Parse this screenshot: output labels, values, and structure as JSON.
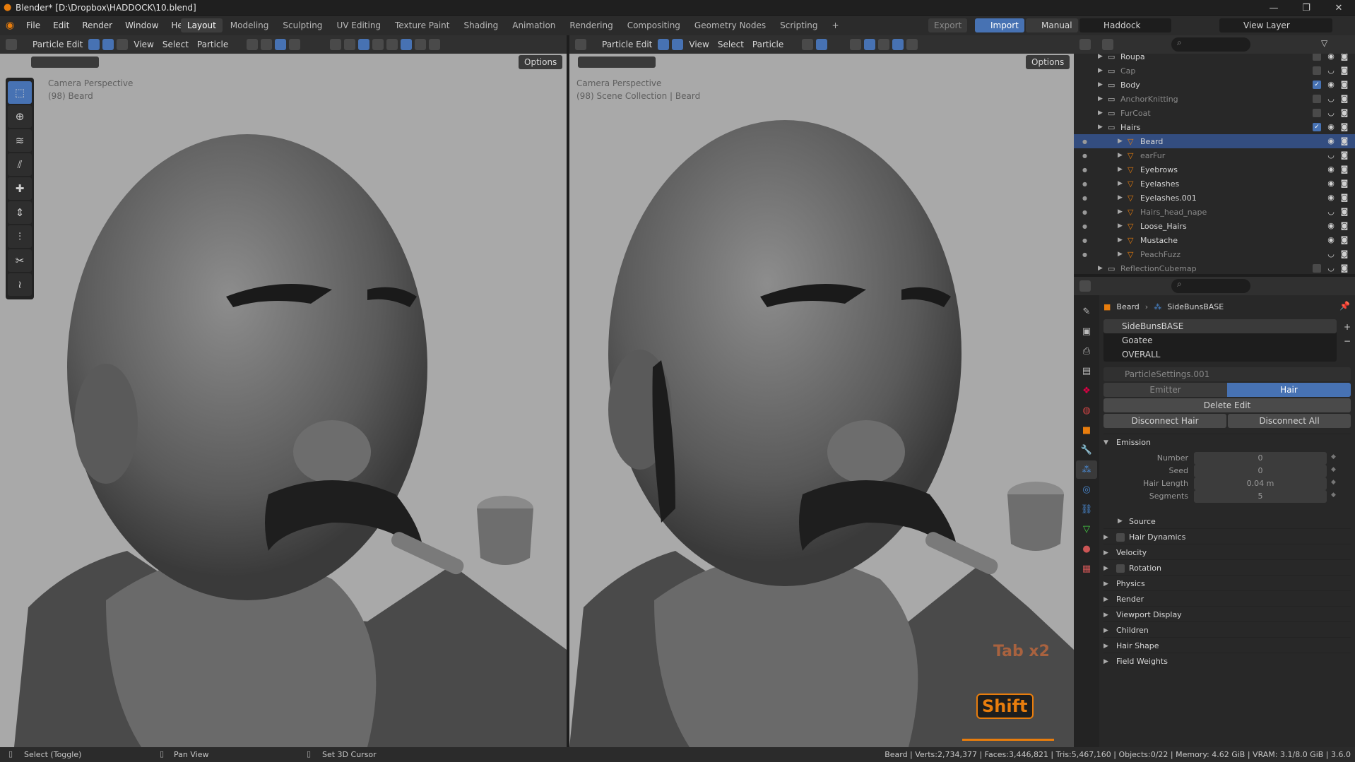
{
  "window": {
    "title": "Blender* [D:\\Dropbox\\HADDOCK\\10.blend]"
  },
  "menu": [
    "File",
    "Edit",
    "Render",
    "Window",
    "Help"
  ],
  "workspaces": [
    "Layout",
    "Modeling",
    "Sculpting",
    "UV Editing",
    "Texture Paint",
    "Shading",
    "Animation",
    "Rendering",
    "Compositing",
    "Geometry Nodes",
    "Scripting"
  ],
  "topright": {
    "export": "Export",
    "import": "Import",
    "manual": "Manual",
    "scene": "Haddock",
    "view_layer": "View Layer"
  },
  "viewport_left": {
    "mode": "Particle Edit",
    "view": "View",
    "select": "Select",
    "particle": "Particle",
    "options": "Options",
    "overlay_line1": "Camera Perspective",
    "overlay_line2": "(98) Beard"
  },
  "viewport_right": {
    "mode": "Particle Edit",
    "view": "View",
    "select": "Select",
    "particle": "Particle",
    "options": "Options",
    "overlay_line1": "Camera Perspective",
    "overlay_line2": "(98) Scene Collection | Beard",
    "hint_tab": "Tab x2",
    "hint_shift": "Shift"
  },
  "outliner": {
    "rows": [
      {
        "name": "Roupa",
        "indent": 0,
        "dim": false,
        "sel": false,
        "checked": false
      },
      {
        "name": "Cap",
        "indent": 0,
        "dim": true,
        "sel": false,
        "checked": false
      },
      {
        "name": "Body",
        "indent": 0,
        "dim": false,
        "sel": false,
        "checked": true
      },
      {
        "name": "AnchorKnitting",
        "indent": 0,
        "dim": true,
        "sel": false,
        "checked": false
      },
      {
        "name": "FurCoat",
        "indent": 0,
        "dim": true,
        "sel": false,
        "checked": false
      },
      {
        "name": "Hairs",
        "indent": 0,
        "dim": false,
        "sel": false,
        "checked": true
      },
      {
        "name": "Beard",
        "indent": 1,
        "dim": false,
        "sel": true,
        "checked": false
      },
      {
        "name": "earFur",
        "indent": 1,
        "dim": true,
        "sel": false,
        "checked": false
      },
      {
        "name": "Eyebrows",
        "indent": 1,
        "dim": false,
        "sel": false,
        "checked": false
      },
      {
        "name": "Eyelashes",
        "indent": 1,
        "dim": false,
        "sel": false,
        "checked": false
      },
      {
        "name": "Eyelashes.001",
        "indent": 1,
        "dim": false,
        "sel": false,
        "checked": false
      },
      {
        "name": "Hairs_head_nape",
        "indent": 1,
        "dim": true,
        "sel": false,
        "checked": false
      },
      {
        "name": "Loose_Hairs",
        "indent": 1,
        "dim": false,
        "sel": false,
        "checked": false
      },
      {
        "name": "Mustache",
        "indent": 1,
        "dim": false,
        "sel": false,
        "checked": false
      },
      {
        "name": "PeachFuzz",
        "indent": 1,
        "dim": true,
        "sel": false,
        "checked": false
      },
      {
        "name": "ReflectionCubemap",
        "indent": 0,
        "dim": true,
        "sel": false,
        "checked": false
      }
    ]
  },
  "properties": {
    "breadcrumb_obj": "Beard",
    "breadcrumb_ps": "SideBunsBASE",
    "systems": [
      "SideBunsBASE",
      "Goatee",
      "OVERALL"
    ],
    "settings_name": "ParticleSettings.001",
    "tab_emitter": "Emitter",
    "tab_hair": "Hair",
    "delete_edit": "Delete Edit",
    "disconnect_hair": "Disconnect Hair",
    "disconnect_all": "Disconnect All",
    "emission": "Emission",
    "fields": [
      {
        "label": "Number",
        "value": "0"
      },
      {
        "label": "Seed",
        "value": "0"
      },
      {
        "label": "Hair Length",
        "value": "0.04 m"
      },
      {
        "label": "Segments",
        "value": "5"
      }
    ],
    "source": "Source",
    "sections": [
      "Hair Dynamics",
      "Velocity",
      "Rotation",
      "Physics",
      "Render",
      "Viewport Display",
      "Children",
      "Hair Shape",
      "Field Weights"
    ]
  },
  "status": {
    "select": "Select (Toggle)",
    "pan": "Pan View",
    "cursor": "Set 3D Cursor",
    "stats": "Beard | Verts:2,734,377 | Faces:3,446,821 | Tris:5,467,160 | Objects:0/22 | Memory: 4.62 GiB | VRAM: 3.1/8.0 GiB | 3.6.0"
  },
  "colors": {
    "accent": "#4772b3",
    "orange": "#e87d0d",
    "viewport_bg": "#a9a9a9"
  }
}
